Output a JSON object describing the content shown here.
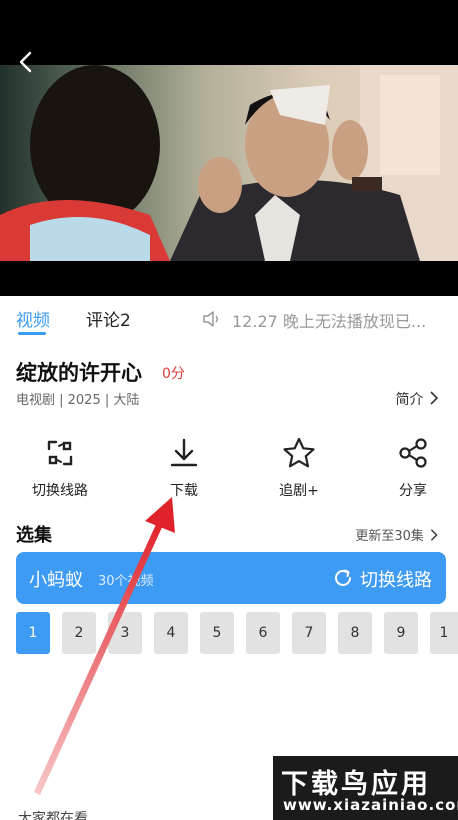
{
  "tabs": {
    "video": "视频",
    "comment": "评论2"
  },
  "notice": "12.27 晚上无法播放现已...",
  "show": {
    "title": "绽放的许开心",
    "score": "0分",
    "meta": "电视剧 | 2025 | 大陆",
    "intro": "简介"
  },
  "actions": [
    {
      "label": "切换线路",
      "icon": "switch-line-icon"
    },
    {
      "label": "下载",
      "icon": "download-icon"
    },
    {
      "label": "追剧+",
      "icon": "star-icon"
    },
    {
      "label": "分享",
      "icon": "share-icon"
    }
  ],
  "episodes": {
    "title": "选集",
    "update": "更新至30集",
    "line_name": "小蚂蚁",
    "line_count": "30个视频",
    "line_switch": "切换线路",
    "items": [
      "1",
      "2",
      "3",
      "4",
      "5",
      "6",
      "7",
      "8",
      "9",
      "1"
    ],
    "active": "1"
  },
  "watermark": {
    "big": "下载鸟应用",
    "small": "www.xiazainiao.com"
  },
  "bottom_cut": "大家都在看",
  "colors": {
    "accent": "#3e9bf3",
    "score": "#e0403a",
    "annotation_arrow": "#e4262b"
  }
}
